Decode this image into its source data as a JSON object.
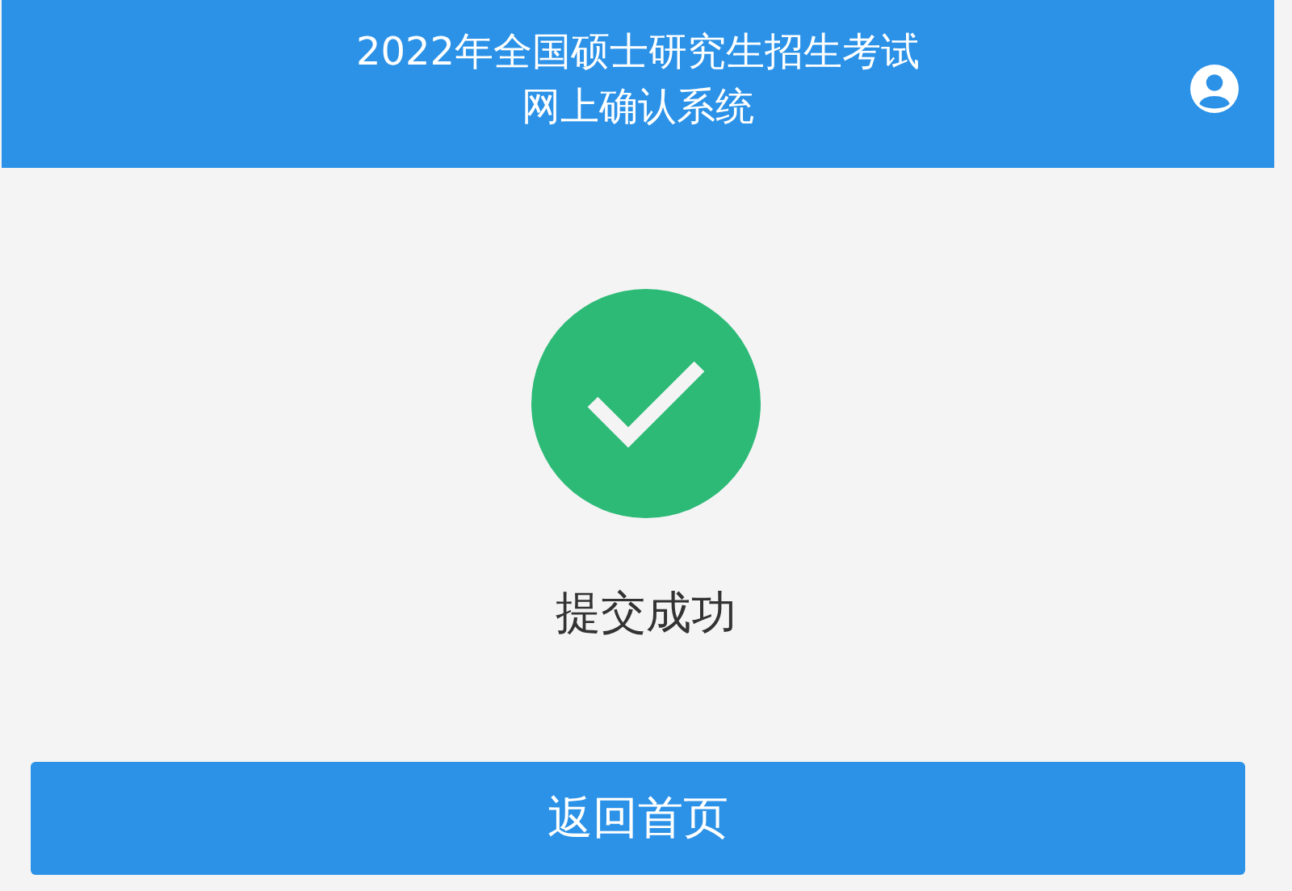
{
  "header": {
    "title_lines": [
      "2022年全国硕士研究生招生考试",
      "网上确认系统"
    ]
  },
  "result": {
    "success": true,
    "message": "提交成功"
  },
  "button": {
    "label": "返回首页"
  }
}
